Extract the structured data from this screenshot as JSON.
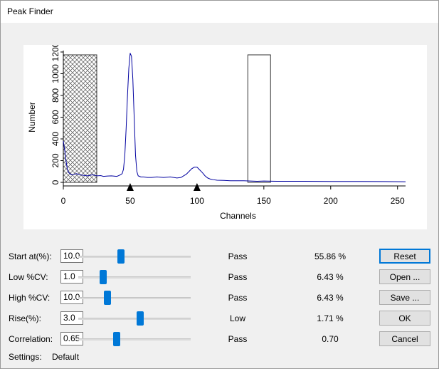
{
  "window": {
    "title": "Peak Finder"
  },
  "chart_data": {
    "type": "line",
    "xlabel": "Channels",
    "ylabel": "Number",
    "xlim": [
      0,
      256
    ],
    "ylim": [
      0,
      1200
    ],
    "xticks": [
      0,
      50,
      100,
      150,
      200,
      250
    ],
    "yticks": [
      0,
      200,
      400,
      600,
      800,
      1000,
      1200
    ],
    "series": [
      {
        "x": [
          0,
          1,
          2,
          3,
          4,
          5,
          6,
          8,
          10,
          12,
          15,
          18,
          20,
          22,
          25,
          28,
          30,
          33,
          36,
          40,
          42,
          44,
          45,
          46,
          47,
          48,
          49,
          50,
          51,
          52,
          53,
          54,
          55,
          56,
          57,
          58,
          60,
          63,
          66,
          70,
          75,
          80,
          85,
          88,
          90,
          92,
          94,
          96,
          98,
          100,
          102,
          104,
          106,
          108,
          110,
          112,
          115,
          120,
          125,
          130,
          135,
          140,
          145,
          150,
          160,
          180,
          200,
          220,
          240,
          256
        ],
        "y": [
          380,
          300,
          200,
          120,
          90,
          80,
          70,
          75,
          80,
          70,
          65,
          60,
          65,
          70,
          60,
          62,
          55,
          58,
          60,
          55,
          65,
          80,
          120,
          250,
          500,
          800,
          1050,
          1190,
          1160,
          950,
          600,
          250,
          100,
          60,
          55,
          50,
          50,
          45,
          45,
          50,
          45,
          50,
          40,
          45,
          60,
          75,
          100,
          125,
          140,
          140,
          115,
          90,
          60,
          40,
          30,
          25,
          20,
          18,
          15,
          15,
          15,
          12,
          10,
          12,
          10,
          10,
          8,
          8,
          7,
          6
        ],
        "color": "#0000a0"
      }
    ],
    "regions": [
      {
        "from": 0,
        "to": 25,
        "pattern": "crosshatch"
      },
      {
        "from": 138,
        "to": 155,
        "pattern": "outline"
      }
    ],
    "markers": [
      50,
      100
    ]
  },
  "controls": [
    {
      "label": "Start at(%):",
      "value": "10.0",
      "slider": 0.38,
      "status": "Pass",
      "pct": "55.86 %",
      "button": "Reset"
    },
    {
      "label": "Low %CV:",
      "value": "1.0",
      "slider": 0.22,
      "status": "Pass",
      "pct": "6.43 %",
      "button": "Open ..."
    },
    {
      "label": "High %CV:",
      "value": "10.0",
      "slider": 0.26,
      "status": "Pass",
      "pct": "6.43 %",
      "button": "Save ..."
    },
    {
      "label": "Rise(%):",
      "value": "3.0",
      "slider": 0.55,
      "status": "Low",
      "pct": "1.71 %",
      "button": "OK"
    },
    {
      "label": "Correlation:",
      "value": "0.65",
      "slider": 0.34,
      "status": "Pass",
      "pct": "0.70",
      "button": "Cancel"
    }
  ],
  "settings": {
    "label": "Settings:",
    "value": "Default"
  }
}
